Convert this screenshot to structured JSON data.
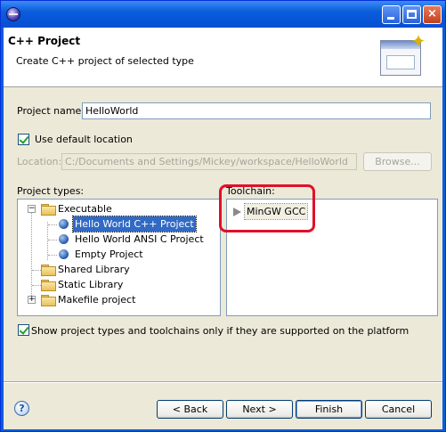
{
  "window": {
    "title_bar": {
      "minimize": "",
      "maximize": "",
      "close": "×"
    }
  },
  "header": {
    "title": "C++ Project",
    "description": "Create C++ project of selected type"
  },
  "project_name": {
    "label": "Project name:",
    "value": "HelloWorld"
  },
  "use_default_location": {
    "label": "Use default location",
    "checked": true
  },
  "location": {
    "label": "Location:",
    "value": "C:/Documents and Settings/Mickey/workspace/HelloWorld",
    "browse_label": "Browse..."
  },
  "project_types": {
    "label": "Project types:",
    "items": [
      {
        "label": "Executable",
        "expanded": true
      },
      {
        "label": "Hello World C++ Project",
        "selected": true
      },
      {
        "label": "Hello World ANSI C Project"
      },
      {
        "label": "Empty Project"
      },
      {
        "label": "Shared Library"
      },
      {
        "label": "Static Library"
      },
      {
        "label": "Makefile project",
        "expanded": false
      }
    ]
  },
  "toolchains": {
    "label": "Toolchain:",
    "items": [
      {
        "label": "MinGW GCC"
      }
    ]
  },
  "show_supported": {
    "label": "Show project types and toolchains only if they are supported on the platform",
    "checked": true
  },
  "buttons": {
    "back": "< Back",
    "next": "Next >",
    "finish": "Finish",
    "cancel": "Cancel",
    "help": "?"
  },
  "colors": {
    "highlight": "#e0102a",
    "selection": "#316ac5",
    "title_bar": "#0a5ddc"
  }
}
